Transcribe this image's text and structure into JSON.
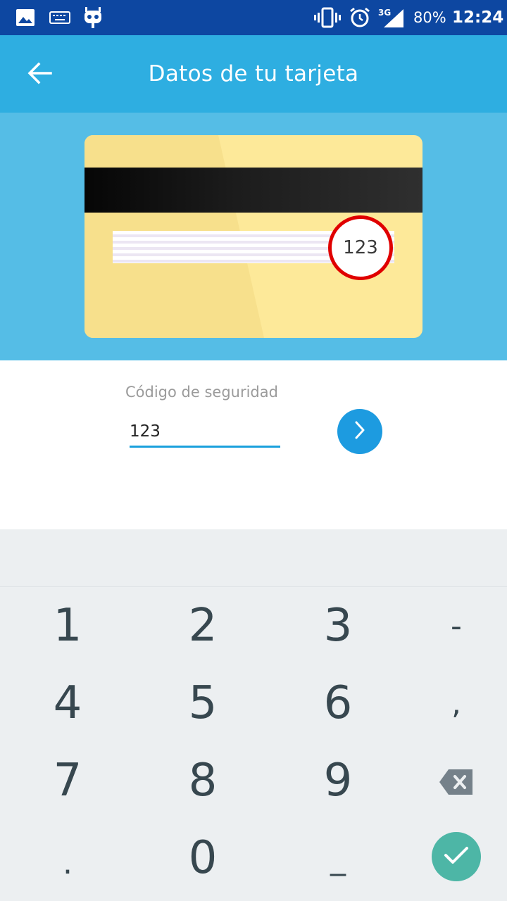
{
  "status_bar": {
    "icons": [
      "image-icon",
      "keyboard-icon",
      "cyanogen-bot-icon",
      "vibrate-icon",
      "alarm-icon",
      "network-3g-icon",
      "battery-icon"
    ],
    "network_label": "3G",
    "battery": "80%",
    "time": "12:24"
  },
  "app_bar": {
    "title": "Datos de tu tarjeta",
    "back_icon": "arrow-back-icon"
  },
  "card_illustration": {
    "highlighted_code": "123",
    "colors": {
      "card": "#fde999",
      "ring": "#e00000",
      "background": "#55bde6"
    }
  },
  "form": {
    "security_code_label": "Código de seguridad",
    "security_code_value": "123",
    "next_icon": "chevron-right-icon"
  },
  "keyboard": {
    "keys": [
      [
        "1",
        "2",
        "3",
        "-"
      ],
      [
        "4",
        "5",
        "6",
        ","
      ],
      [
        "7",
        "8",
        "9",
        ""
      ],
      [
        ".",
        "0",
        "_",
        ""
      ]
    ],
    "backspace_icon": "backspace-icon",
    "done_icon": "check-icon"
  },
  "colors": {
    "status_bar": "#0d47a1",
    "app_bar": "#2eaee1",
    "accent": "#1d9be0",
    "done": "#4db6a6"
  }
}
